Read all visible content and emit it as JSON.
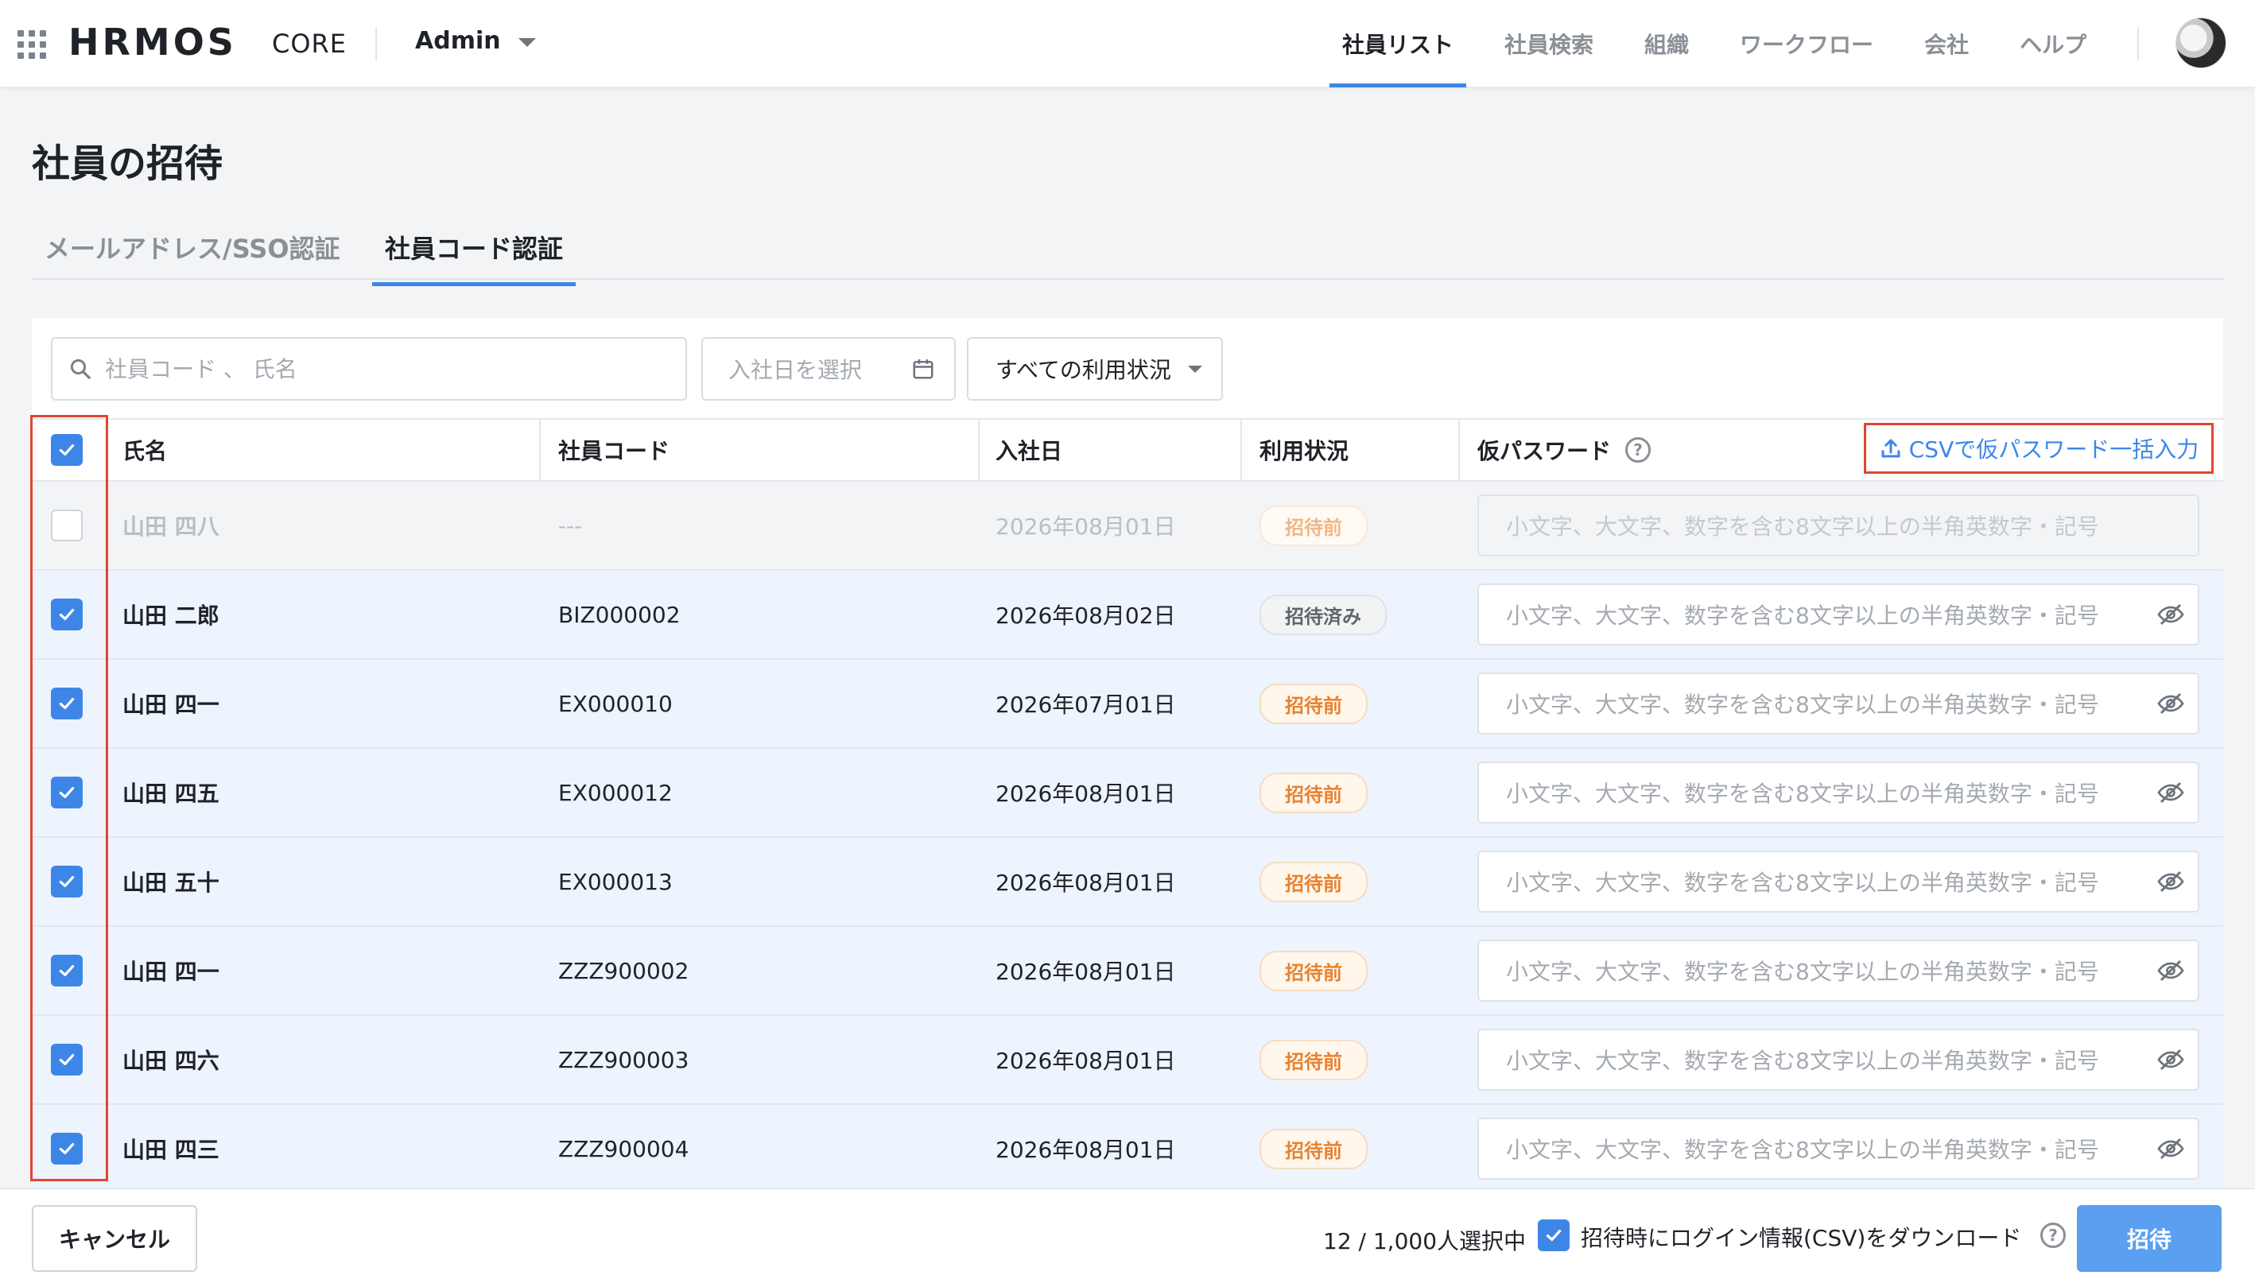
{
  "header": {
    "logo": "HRMOS",
    "logo_sub": "CORE",
    "role": "Admin",
    "nav": [
      "社員リスト",
      "社員検索",
      "組織",
      "ワークフロー",
      "会社",
      "ヘルプ"
    ],
    "nav_active_index": 0
  },
  "page": {
    "title": "社員の招待",
    "tabs": [
      "メールアドレス/SSO認証",
      "社員コード認証"
    ],
    "active_tab_index": 1
  },
  "filters": {
    "search_placeholder": "社員コード 、 氏名",
    "date_placeholder": "入社日を選択",
    "status_value": "すべての利用状況"
  },
  "table": {
    "headers": {
      "name": "氏名",
      "code": "社員コード",
      "date": "入社日",
      "status": "利用状況",
      "password": "仮パスワード"
    },
    "csv_button": "CSVで仮パスワード一括入力",
    "rows": [
      {
        "checked": false,
        "disabled": true,
        "name": "山田 四八",
        "code": "---",
        "date": "2026年08月01日",
        "status": "招待前",
        "status_type": "pending",
        "password_placeholder": "小文字、大文字、数字を含む8文字以上の半角英数字・記号"
      },
      {
        "checked": true,
        "disabled": false,
        "name": "山田 二郎",
        "code": "BIZ000002",
        "date": "2026年08月02日",
        "status": "招待済み",
        "status_type": "done",
        "password_placeholder": "小文字、大文字、数字を含む8文字以上の半角英数字・記号"
      },
      {
        "checked": true,
        "disabled": false,
        "name": "山田 四一",
        "code": "EX000010",
        "date": "2026年07月01日",
        "status": "招待前",
        "status_type": "pending",
        "password_placeholder": "小文字、大文字、数字を含む8文字以上の半角英数字・記号"
      },
      {
        "checked": true,
        "disabled": false,
        "name": "山田 四五",
        "code": "EX000012",
        "date": "2026年08月01日",
        "status": "招待前",
        "status_type": "pending",
        "password_placeholder": "小文字、大文字、数字を含む8文字以上の半角英数字・記号"
      },
      {
        "checked": true,
        "disabled": false,
        "name": "山田 五十",
        "code": "EX000013",
        "date": "2026年08月01日",
        "status": "招待前",
        "status_type": "pending",
        "password_placeholder": "小文字、大文字、数字を含む8文字以上の半角英数字・記号"
      },
      {
        "checked": true,
        "disabled": false,
        "name": "山田 四一",
        "code": "ZZZ900002",
        "date": "2026年08月01日",
        "status": "招待前",
        "status_type": "pending",
        "password_placeholder": "小文字、大文字、数字を含む8文字以上の半角英数字・記号"
      },
      {
        "checked": true,
        "disabled": false,
        "name": "山田 四六",
        "code": "ZZZ900003",
        "date": "2026年08月01日",
        "status": "招待前",
        "status_type": "pending",
        "password_placeholder": "小文字、大文字、数字を含む8文字以上の半角英数字・記号"
      },
      {
        "checked": true,
        "disabled": false,
        "name": "山田 四三",
        "code": "ZZZ900004",
        "date": "2026年08月01日",
        "status": "招待前",
        "status_type": "pending",
        "password_placeholder": "小文字、大文字、数字を含む8文字以上の半角英数字・記号"
      }
    ]
  },
  "footer": {
    "cancel": "キャンセル",
    "count": "12 / 1,000人選択中",
    "download_checked": true,
    "download_label": "招待時にログイン情報(CSV)をダウンロード",
    "invite": "招待"
  },
  "colors": {
    "accent": "#3d86e8",
    "highlight_box": "#e2452f",
    "status_pending": "#e8822f",
    "selected_row_bg": "#edf4fd"
  },
  "icons": [
    "app-grid-icon",
    "chevron-down-icon",
    "search-icon",
    "calendar-icon",
    "help-icon",
    "upload-icon",
    "checkbox-check-icon",
    "eye-off-icon",
    "avatar"
  ]
}
